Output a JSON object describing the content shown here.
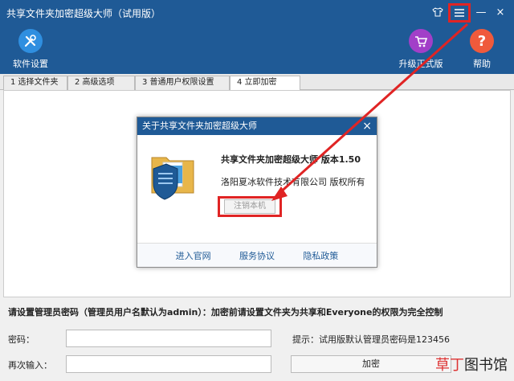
{
  "app": {
    "title": "共享文件夹加密超级大师（试用版）"
  },
  "window_controls": {
    "shirt_icon": "shirt-icon",
    "menu_icon": "menu-icon",
    "minimize": "—",
    "close": "×"
  },
  "toolbar": {
    "settings_label": "软件设置",
    "upgrade_label": "升级正式版",
    "help_label": "帮助"
  },
  "tabs": [
    {
      "label": "1 选择文件夹"
    },
    {
      "label": "2 高级选项"
    },
    {
      "label": "3 普通用户权限设置"
    },
    {
      "label": "4 立即加密"
    }
  ],
  "dialog": {
    "title": "关于共享文件夹加密超级大师",
    "product": "共享文件夹加密超级大师 版本1.50",
    "company": "洛阳夏冰软件技术有限公司 版权所有",
    "unregister": "注销本机",
    "links": [
      "进入官网",
      "服务协议",
      "隐私政策"
    ]
  },
  "form": {
    "notice": "请设置管理员密码（管理员用户名默认为admin）：加密前请设置文件夹为共享和Everyone的权限为完全控制",
    "password_label": "密码：",
    "password_value": "",
    "confirm_label": "再次输入：",
    "confirm_value": "",
    "hint": "提示：试用版默认管理员密码是123456",
    "encrypt_button": "加密"
  },
  "watermark": {
    "red": "草丁",
    "black": "图书馆"
  },
  "colors": {
    "titlebar": "#1f5a96",
    "highlight": "#e02424",
    "link": "#1f5a96"
  }
}
